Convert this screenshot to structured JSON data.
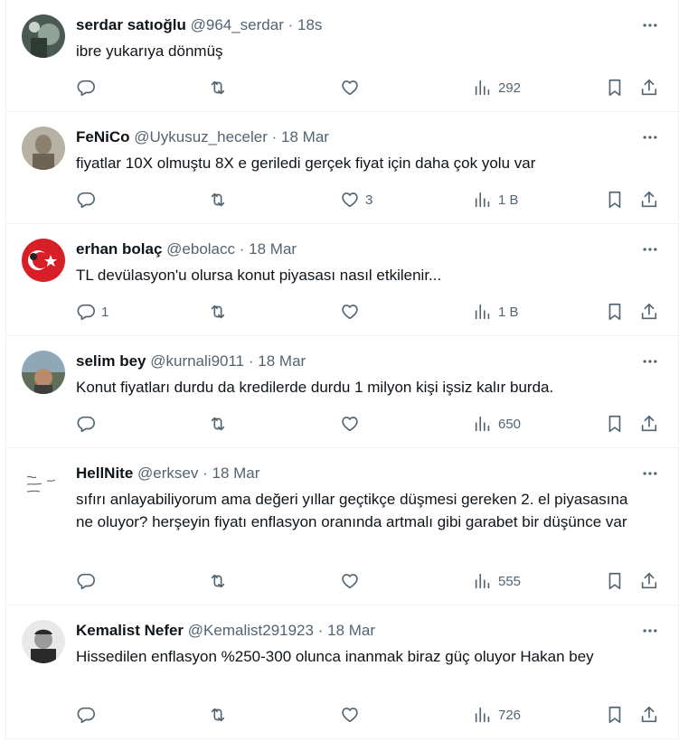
{
  "tweets": [
    {
      "name": "serdar satıoğlu",
      "handle": "@964_serdar",
      "sep": "·",
      "time": "18s",
      "text": "ibre yukarıya dönmüş",
      "replies": "",
      "retweets": "",
      "likes": "",
      "views": "292"
    },
    {
      "name": "FeNiCo",
      "handle": "@Uykusuz_heceler",
      "sep": "·",
      "time": "18 Mar",
      "text": "fiyatlar 10X olmuştu 8X e geriledi gerçek fiyat için daha çok yolu var",
      "replies": "",
      "retweets": "",
      "likes": "3",
      "views": "1 B"
    },
    {
      "name": "erhan bolaç",
      "handle": "@ebolacc",
      "sep": "·",
      "time": "18 Mar",
      "text": "TL devülasyon'u olursa konut piyasası nasıl etkilenir...",
      "replies": "1",
      "retweets": "",
      "likes": "",
      "views": "1 B"
    },
    {
      "name": "selim bey",
      "handle": "@kurnali9011",
      "sep": "·",
      "time": "18 Mar",
      "text": "Konut fiyatları durdu da kredilerde durdu 1 milyon kişi işsiz kalır burda.",
      "replies": "",
      "retweets": "",
      "likes": "",
      "views": "650"
    },
    {
      "name": "HellNite",
      "handle": "@erksev",
      "sep": "·",
      "time": "18 Mar",
      "text": "sıfırı anlayabiliyorum ama değeri yıllar geçtikçe düşmesi gereken 2. el piyasasına ne oluyor? herşeyin fiyatı enflasyon oranında artmalı gibi garabet bir düşünce var",
      "replies": "",
      "retweets": "",
      "likes": "",
      "views": "555"
    },
    {
      "name": "Kemalist Nefer",
      "handle": "@Kemalist291923",
      "sep": "·",
      "time": "18 Mar",
      "text": "Hissedilen enflasyon %250-300 olunca inanmak biraz güç oluyor Hakan bey",
      "replies": "",
      "retweets": "",
      "likes": "",
      "views": "726"
    }
  ],
  "icons": {
    "reply": "reply-icon",
    "retweet": "retweet-icon",
    "like": "heart-icon",
    "views": "views-chart-icon",
    "bookmark": "bookmark-icon",
    "share": "share-icon",
    "more": "more-dots-icon"
  },
  "colors": {
    "secondary_text": "#536471",
    "divider": "#eff3f4",
    "primary_text": "#0f1419"
  }
}
